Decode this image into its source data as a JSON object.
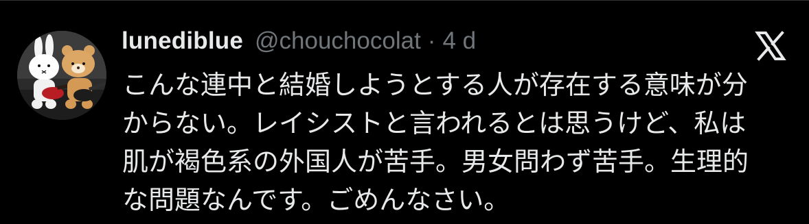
{
  "tweet": {
    "author": {
      "display_name": "lunediblue",
      "handle": "@chouchocolat",
      "avatar_icon": "profile-avatar-plush-toys"
    },
    "separator": "·",
    "timestamp": "4 d",
    "platform_icon": "x-logo-icon",
    "text_lines": [
      "こんな連中と結婚しようとする人が存在する意味が分",
      "からない。レイシストと言われるとは思うけど、私は",
      "肌が褐色系の外国人が苦手。男女問わず苦手。生理的",
      "な問題なんです。ごめんなさい。"
    ]
  },
  "colors": {
    "background": "#000000",
    "primary_text": "#e7e9ea",
    "secondary_text": "#71767b",
    "divider": "#2f3336"
  }
}
